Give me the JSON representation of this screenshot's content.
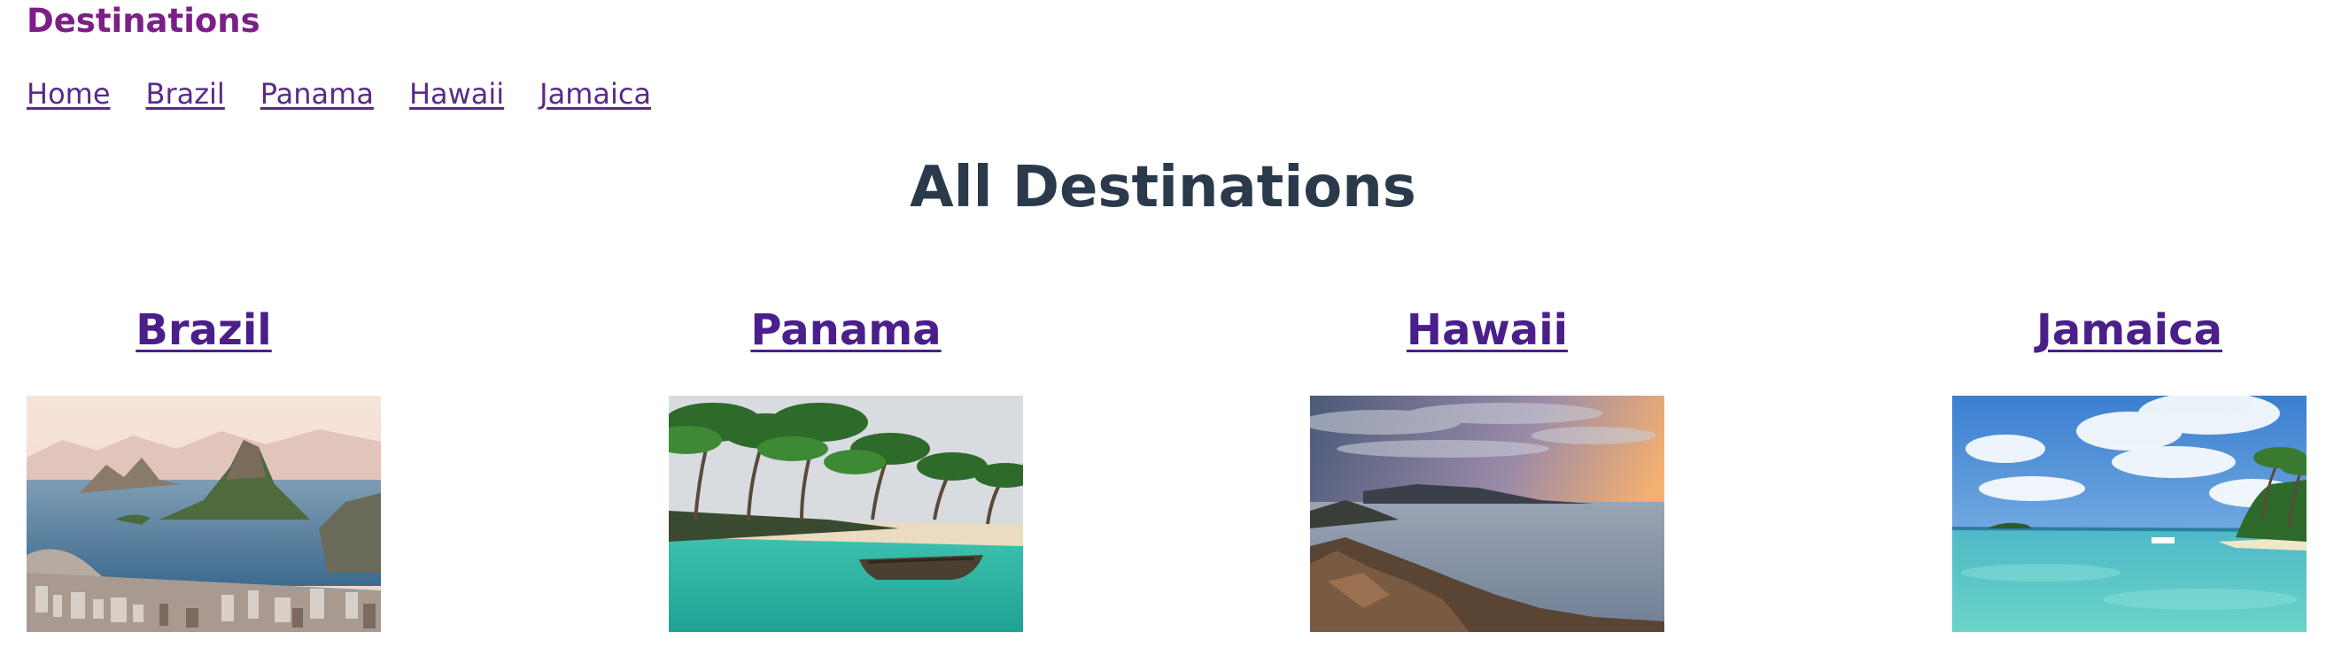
{
  "header": {
    "site_title": "Destinations"
  },
  "nav": {
    "items": [
      {
        "label": "Home"
      },
      {
        "label": "Brazil"
      },
      {
        "label": "Panama"
      },
      {
        "label": "Hawaii"
      },
      {
        "label": "Jamaica"
      }
    ]
  },
  "main": {
    "title": "All Destinations",
    "destinations": [
      {
        "name": "Brazil"
      },
      {
        "name": "Panama"
      },
      {
        "name": "Hawaii"
      },
      {
        "name": "Jamaica"
      }
    ]
  },
  "colors": {
    "site_title": "#7b1f86",
    "link": "#4a1f8a",
    "heading": "#2a3a4a"
  }
}
